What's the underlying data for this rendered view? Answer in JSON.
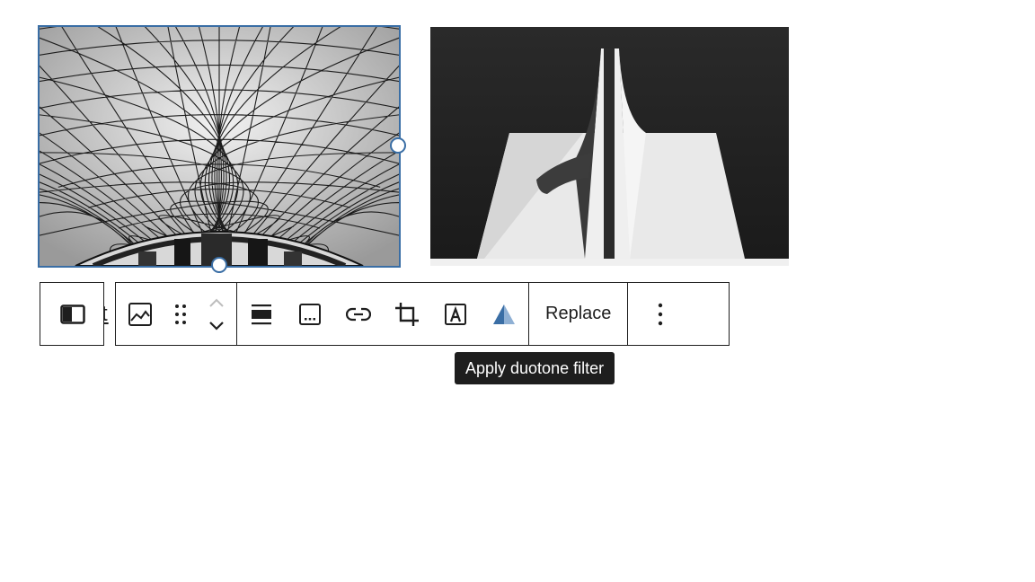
{
  "gallery": {
    "images": [
      {
        "subject": "geometric glass lattice roof over rotunda (black and white)",
        "selected": true
      },
      {
        "subject": "white concrete architecture with tall central spire against dark sky (black and white)",
        "selected": false
      }
    ]
  },
  "caption_fragment": "ct",
  "toolbar": {
    "parent_selector_icon": "columns-block-icon",
    "image_block_icon": "image-icon",
    "drag_icon": "drag-handle-icon",
    "move_up_icon": "chevron-up-icon",
    "move_down_icon": "chevron-down-icon",
    "align_icon": "align-full-icon",
    "caption_icon": "caption-icon",
    "link_icon": "link-icon",
    "crop_icon": "crop-icon",
    "text_overlay_icon": "text-over-image-icon",
    "duotone_icon": "duotone-filter-icon",
    "replace_label": "Replace",
    "options_icon": "more-vertical-icon"
  },
  "tooltip": {
    "text": "Apply duotone filter"
  },
  "colors": {
    "selection": "#3a6ea5",
    "duotone_active": "#3a6ea5",
    "text": "#1e1e1e"
  }
}
